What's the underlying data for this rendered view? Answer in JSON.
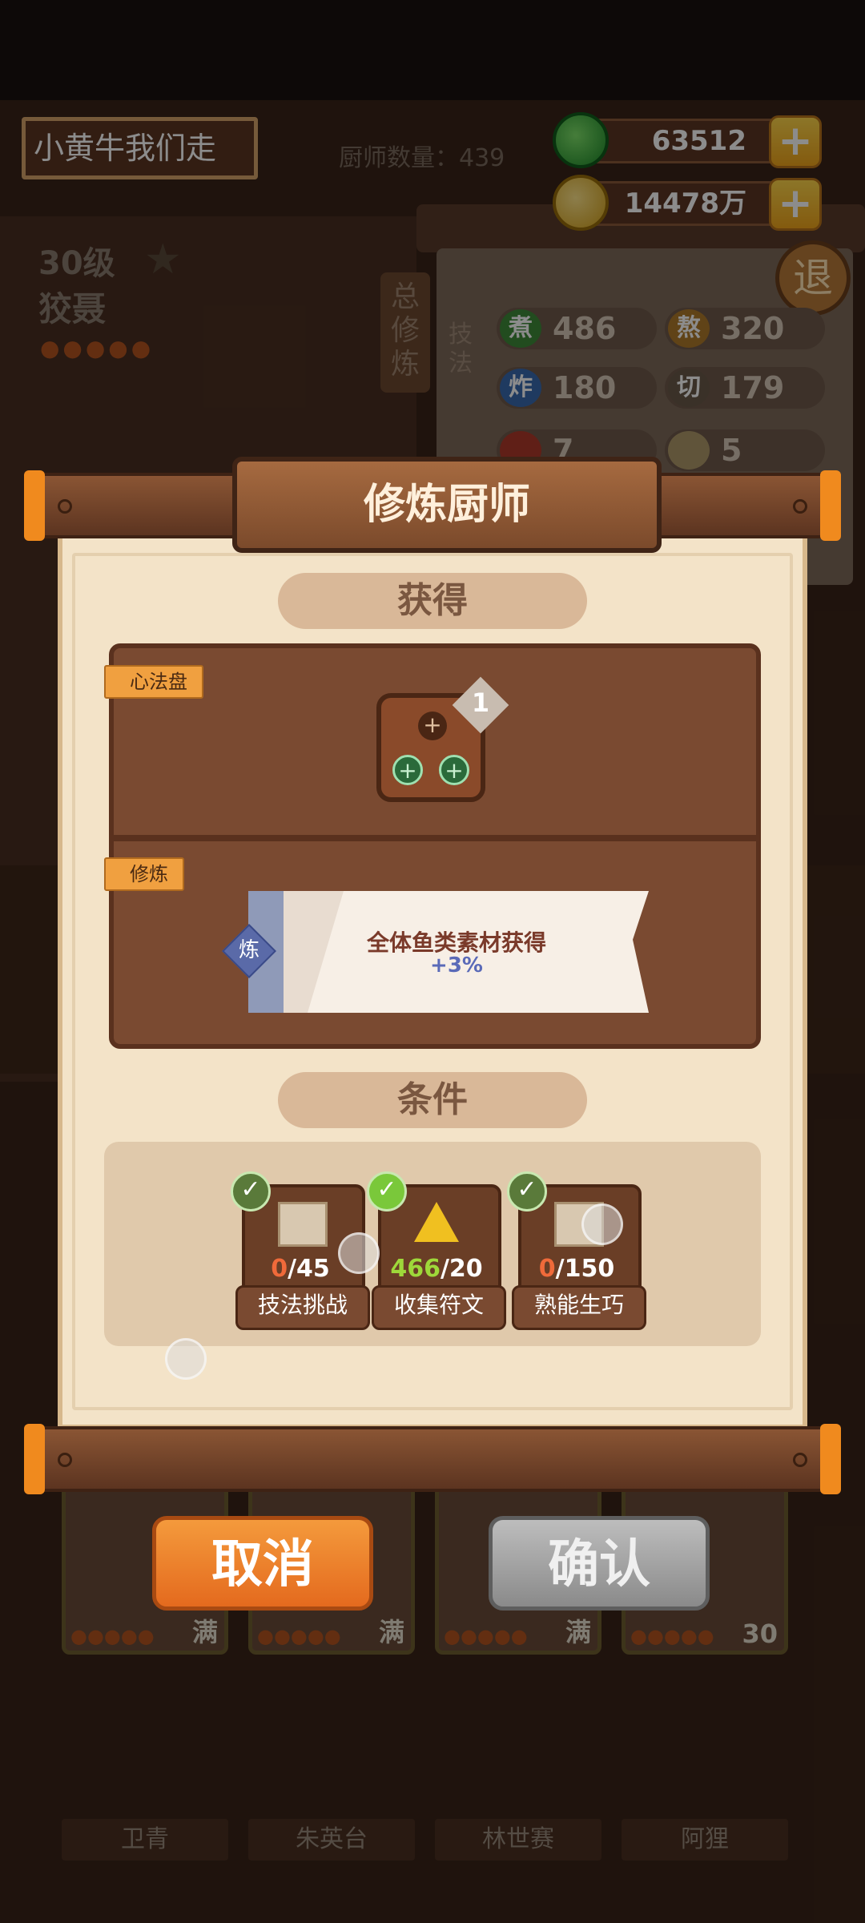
{
  "header": {
    "player_name": "小黄牛我们走",
    "chef_count_label": "厨师数量：439",
    "jade": "63512",
    "coins": "14478万",
    "back_label": "退"
  },
  "chef_panel": {
    "level": "30级",
    "name": "狡聂",
    "total_train": "总修炼",
    "skill_label": "技法",
    "skills": [
      {
        "key": "煮",
        "value": "486",
        "color": "#3e8a3a"
      },
      {
        "key": "熬",
        "value": "320",
        "color": "#b07a2a"
      },
      {
        "key": "炸",
        "value": "180",
        "color": "#3a6ab0"
      },
      {
        "key": "切",
        "value": "179",
        "color": "#6a5a4a"
      },
      {
        "key": "",
        "value": "7",
        "color": "#b03a2a"
      },
      {
        "key": "",
        "value": "5",
        "color": "#b09a6a"
      }
    ]
  },
  "modal": {
    "title": "修炼厨师",
    "gain_header": "获得",
    "heart_tag": "心法盘",
    "heart_count": "1",
    "train_tag": "修炼",
    "bonus_badge": "炼",
    "bonus_line1": "全体鱼类素材获得",
    "bonus_line2": "+3%",
    "conditions_header": "条件",
    "conditions": [
      {
        "current": "0",
        "required": "/45",
        "label": "技法挑战",
        "icon": "scroll-icon"
      },
      {
        "current": "466",
        "required": "/20",
        "label": "收集符文",
        "icon": "rune-icon"
      },
      {
        "current": "0",
        "required": "/150",
        "label": "熟能生巧",
        "icon": "scroll-icon"
      }
    ],
    "cancel_label": "取消",
    "confirm_label": "确认"
  },
  "chef_list": [
    {
      "name": "卫青",
      "level": "满"
    },
    {
      "name": "朱英台",
      "level": "满"
    },
    {
      "name": "林世赛",
      "level": "满"
    },
    {
      "name": "阿狸",
      "level": "30"
    }
  ],
  "colors": {
    "accent_orange": "#e46a1e",
    "condition_fail": "#f06a3a",
    "condition_pass": "#9ed83a"
  }
}
